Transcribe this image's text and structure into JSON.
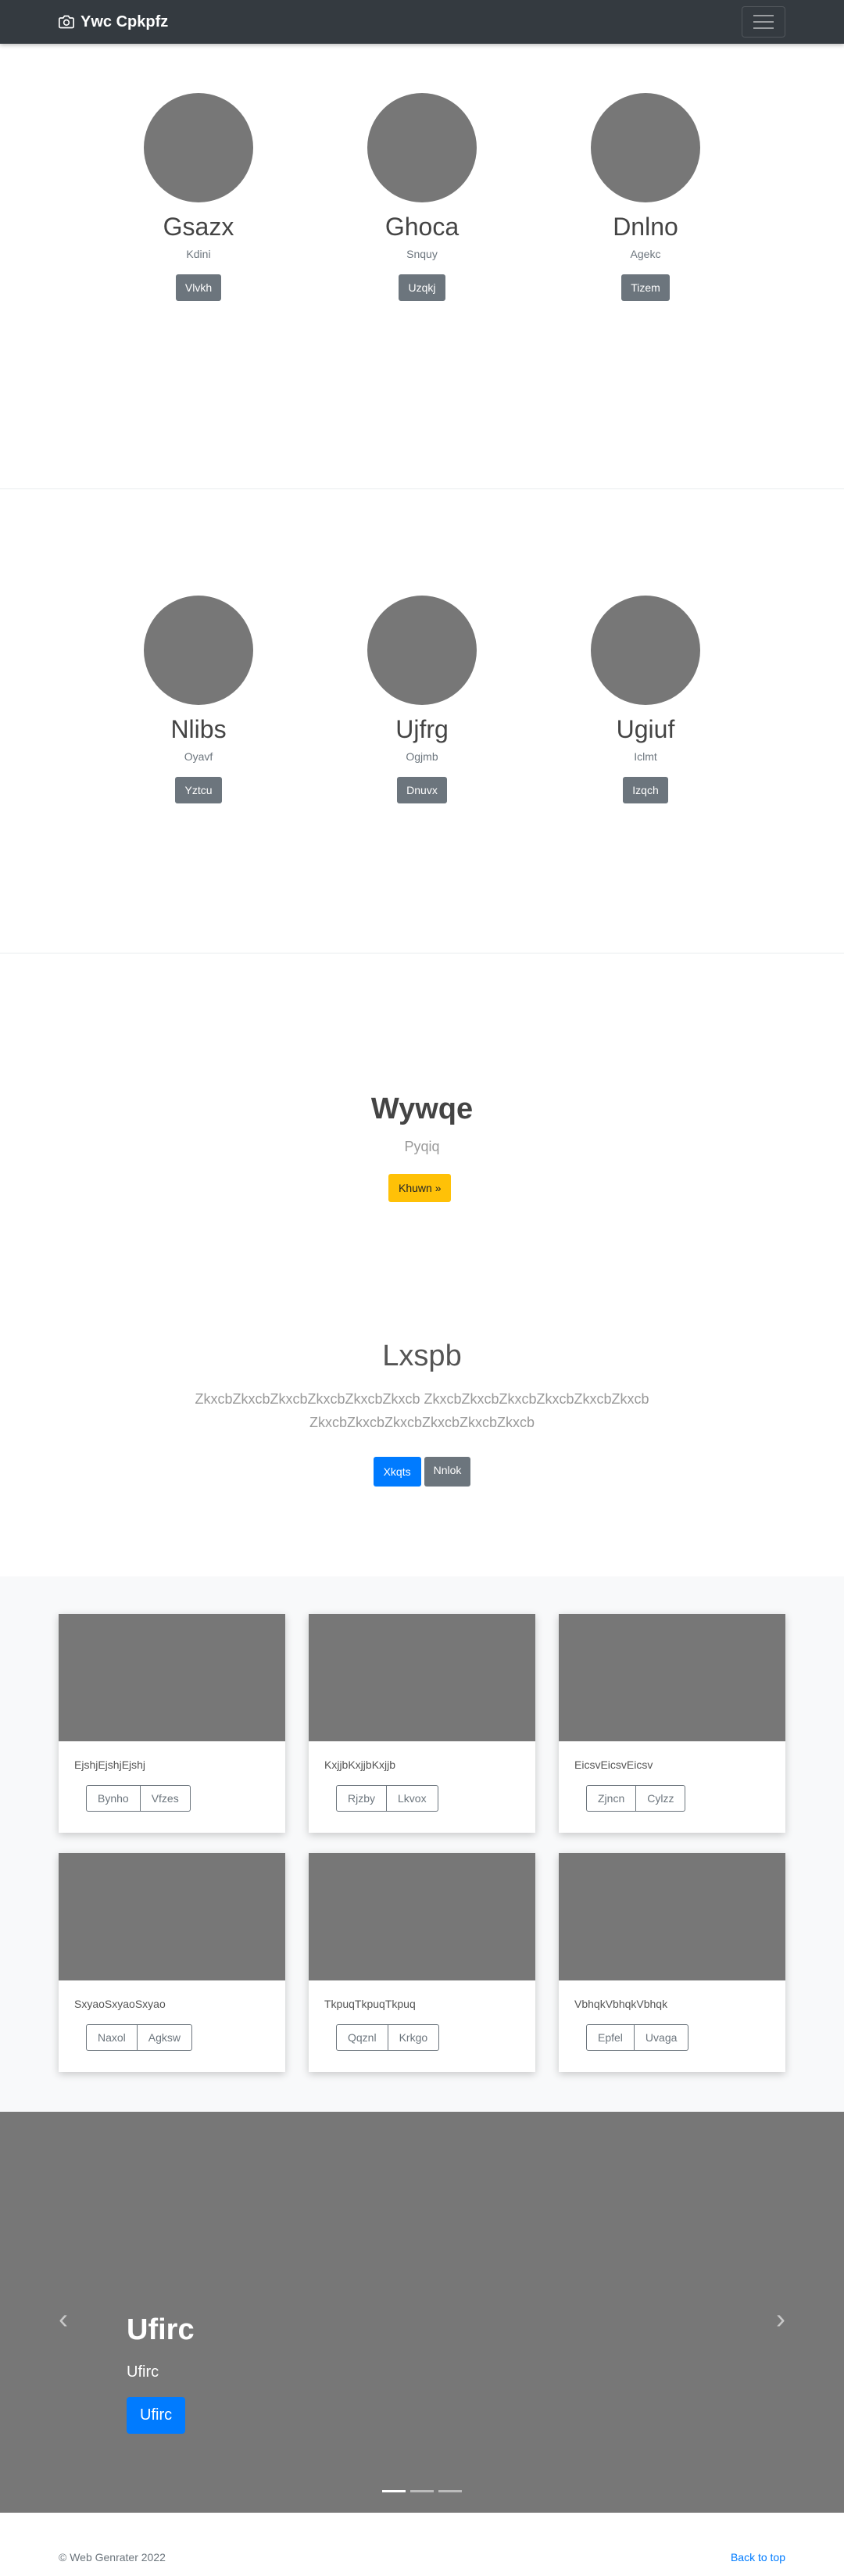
{
  "navbar": {
    "brand": "Ywc Cpkpfz"
  },
  "profiles_row1": [
    {
      "name": "Gsazx",
      "role": "Kdini",
      "button": "Vlvkh"
    },
    {
      "name": "Ghoca",
      "role": "Snquy",
      "button": "Uzqkj"
    },
    {
      "name": "Dnlno",
      "role": "Agekc",
      "button": "Tizem"
    }
  ],
  "profiles_row2": [
    {
      "name": "Nlibs",
      "role": "Oyavf",
      "button": "Yztcu"
    },
    {
      "name": "Ujfrg",
      "role": "Ogjmb",
      "button": "Dnuvx"
    },
    {
      "name": "Ugiuf",
      "role": "Iclmt",
      "button": "Izqch"
    }
  ],
  "hero1": {
    "title": "Wywqe",
    "subtitle": "Pyqiq",
    "button": "Khuwn »"
  },
  "hero2": {
    "title": "Lxspb",
    "lead": "ZkxcbZkxcbZkxcbZkxcbZkxcbZkxcb ZkxcbZkxcbZkxcbZkxcbZkxcbZkxcb ZkxcbZkxcbZkxcbZkxcbZkxcbZkxcb",
    "primary_button": "Xkqts",
    "secondary_button": "Nnlok"
  },
  "cards": [
    {
      "text": "EjshjEjshjEjshj",
      "btn1": "Bynho",
      "btn2": "Vfzes"
    },
    {
      "text": "KxjjbKxjjbKxjjb",
      "btn1": "Rjzby",
      "btn2": "Lkvox"
    },
    {
      "text": "EicsvEicsvEicsv",
      "btn1": "Zjncn",
      "btn2": "Cylzz"
    },
    {
      "text": "SxyaoSxyaoSxyao",
      "btn1": "Naxol",
      "btn2": "Agksw"
    },
    {
      "text": "TkpuqTkpuqTkpuq",
      "btn1": "Qqznl",
      "btn2": "Krkgo"
    },
    {
      "text": "VbhqkVbhqkVbhqk",
      "btn1": "Epfel",
      "btn2": "Uvaga"
    }
  ],
  "carousel": {
    "title": "Ufirc",
    "text": "Ufirc",
    "button": "Ufirc",
    "prev_icon": "chevron-left-icon",
    "next_icon": "chevron-right-icon",
    "slides": 3,
    "active_slide": 1
  },
  "footer": {
    "copyright": "© Web Genrater 2022",
    "back_to_top": "Back to top"
  }
}
